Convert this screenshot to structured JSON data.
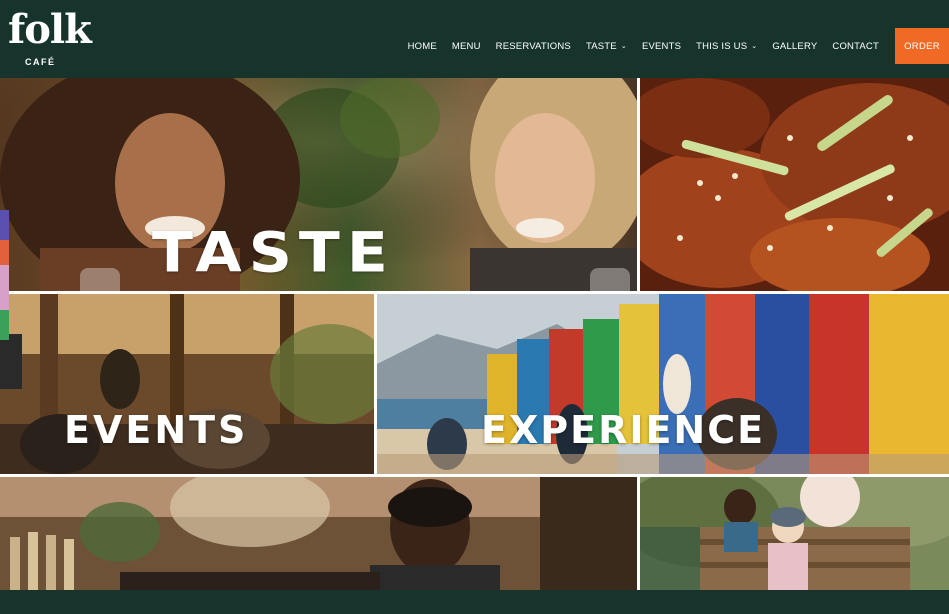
{
  "brand": {
    "name": "folk",
    "sub": "CAFÉ"
  },
  "nav": {
    "items": [
      {
        "label": "HOME",
        "dropdown": false
      },
      {
        "label": "MENU",
        "dropdown": false
      },
      {
        "label": "RESERVATIONS",
        "dropdown": false
      },
      {
        "label": "TASTE",
        "dropdown": true
      },
      {
        "label": "EVENTS",
        "dropdown": false
      },
      {
        "label": "THIS IS US",
        "dropdown": true
      },
      {
        "label": "GALLERY",
        "dropdown": false
      },
      {
        "label": "CONTACT",
        "dropdown": false
      }
    ],
    "order_label": "ORDER"
  },
  "tiles": {
    "taste_label": "TASTE",
    "events_label": "EVENTS",
    "experience_label": "EXPERIENCE"
  },
  "colors": {
    "header_bg": "#17342c",
    "accent": "#f06a25",
    "text": "#ffffff"
  },
  "icons": [
    "chevron-down-icon"
  ]
}
